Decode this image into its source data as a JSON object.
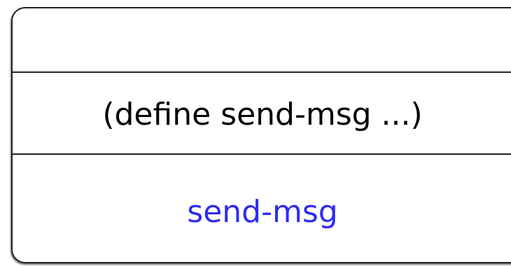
{
  "definition": {
    "text": "(define send-msg ...)"
  },
  "output": {
    "text": "send-msg",
    "color": "#2d2cf2"
  }
}
